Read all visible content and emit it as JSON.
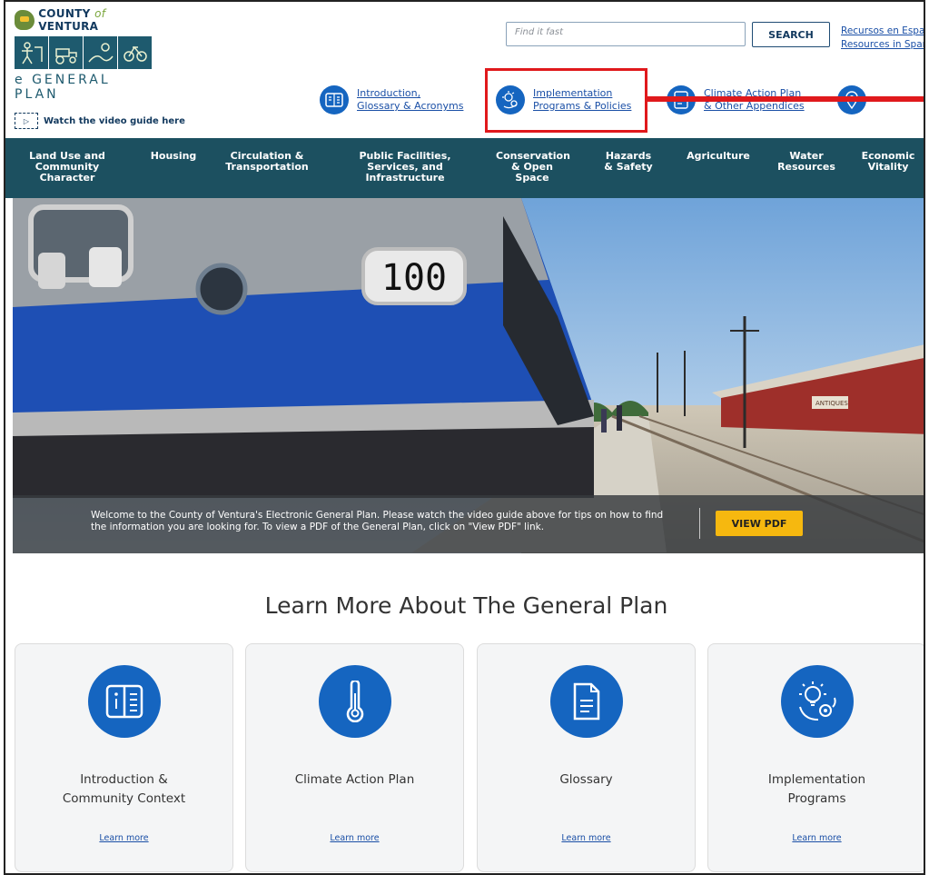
{
  "header": {
    "logo": {
      "county_name_prefix": "COUNTY",
      "county_name_of": "of",
      "county_name_suffix": "VENTURA",
      "product_name": "e GENERAL PLAN"
    },
    "video_link_label": "Watch the video guide here",
    "search": {
      "placeholder": "Find it fast",
      "button_label": "SEARCH"
    },
    "language_links": [
      "Recursos en Español",
      "Resources in Spanish"
    ],
    "quick_links": [
      {
        "label_line1": "Introduction,",
        "label_line2": "Glossary & Acronyms",
        "icon": "book-icon"
      },
      {
        "label_line1": "Implementation",
        "label_line2": "Programs & Policies",
        "icon": "lightbulb-gear-icon"
      },
      {
        "label_line1": "Climate Action Plan",
        "label_line2": "& Other Appendices",
        "icon": "document-icon"
      },
      {
        "label_line1": "",
        "label_line2": "",
        "icon": "map-pin-icon"
      }
    ]
  },
  "nav": {
    "items": [
      "Land Use and Community Character",
      "Housing",
      "Circulation & Transportation",
      "Public Facilities, Services, and Infrastructure",
      "Conservation & Open Space",
      "Hazards & Safety",
      "Agriculture",
      "Water Resources",
      "Economic Vitality"
    ]
  },
  "hero": {
    "caption": "Welcome to the County of Ventura's Electronic General Plan. Please watch the video guide above for tips on how to find the information you are looking for. To view a PDF of the General Plan, click on \"View PDF\" link.",
    "button_label": "VIEW PDF",
    "train_number": "100",
    "building_sign": "ANTIQUES"
  },
  "learn_more": {
    "title": "Learn More About The General Plan",
    "cards": [
      {
        "title_line1": "Introduction &",
        "title_line2": "Community Context",
        "link": "Learn more",
        "icon": "book-icon"
      },
      {
        "title_line1": "Climate Action Plan",
        "title_line2": "",
        "link": "Learn more",
        "icon": "thermometer-icon"
      },
      {
        "title_line1": "Glossary",
        "title_line2": "",
        "link": "Learn more",
        "icon": "document-icon"
      },
      {
        "title_line1": "Implementation",
        "title_line2": "Programs",
        "link": "Learn more",
        "icon": "lightbulb-gear-icon"
      }
    ]
  },
  "colors": {
    "nav_bg": "#1c5060",
    "icon_blue": "#1565c0",
    "accent_yellow": "#f6b80f",
    "annotation_red": "#e0191c",
    "link_blue": "#1a4fa6"
  }
}
